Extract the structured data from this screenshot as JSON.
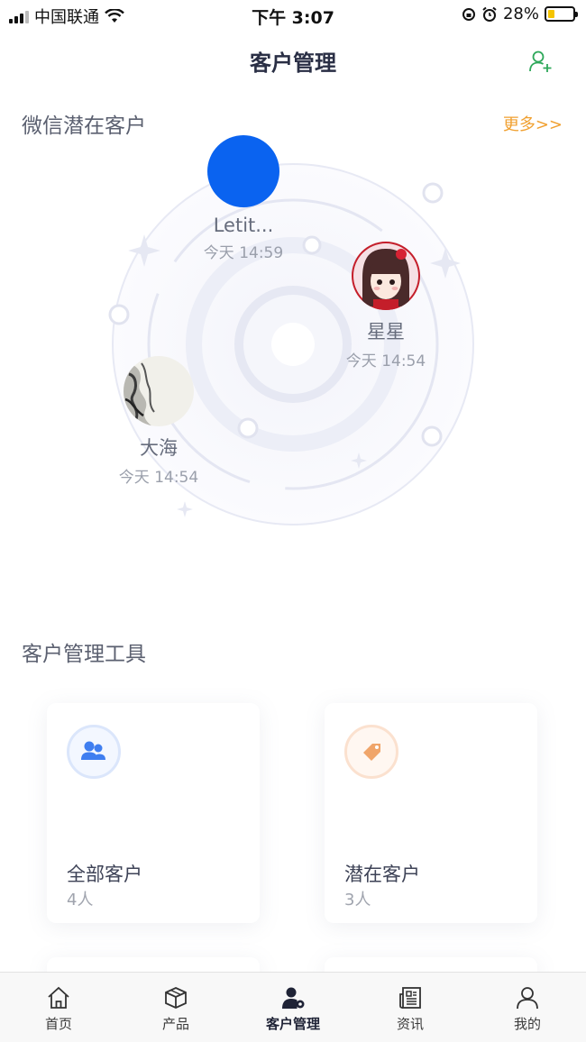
{
  "status_bar": {
    "carrier": "中国联通",
    "time": "下午 3:07",
    "battery": "28%",
    "battery_level": 0.28
  },
  "header": {
    "title": "客户管理"
  },
  "wechat_section": {
    "title": "微信潜在客户",
    "more_label": "更多>>",
    "people": [
      {
        "name": "Letit...",
        "time": "今天 14:59"
      },
      {
        "name": "星星",
        "time": "今天 14:54"
      },
      {
        "name": "大海",
        "time": "今天 14:54"
      }
    ]
  },
  "tools_section": {
    "title": "客户管理工具",
    "cards": [
      {
        "label": "全部客户",
        "count": "4人"
      },
      {
        "label": "潜在客户",
        "count": "3人"
      }
    ]
  },
  "tabbar": {
    "tabs": [
      {
        "label": "首页",
        "icon": "home-icon"
      },
      {
        "label": "产品",
        "icon": "box-icon"
      },
      {
        "label": "客户管理",
        "icon": "customer-manage-icon"
      },
      {
        "label": "资讯",
        "icon": "news-icon"
      },
      {
        "label": "我的",
        "icon": "profile-icon"
      }
    ],
    "active": "客户管理"
  },
  "colors": {
    "accent": "#f0a030",
    "blue": "#0a63f0",
    "add_user_green": "#2ea85a"
  }
}
